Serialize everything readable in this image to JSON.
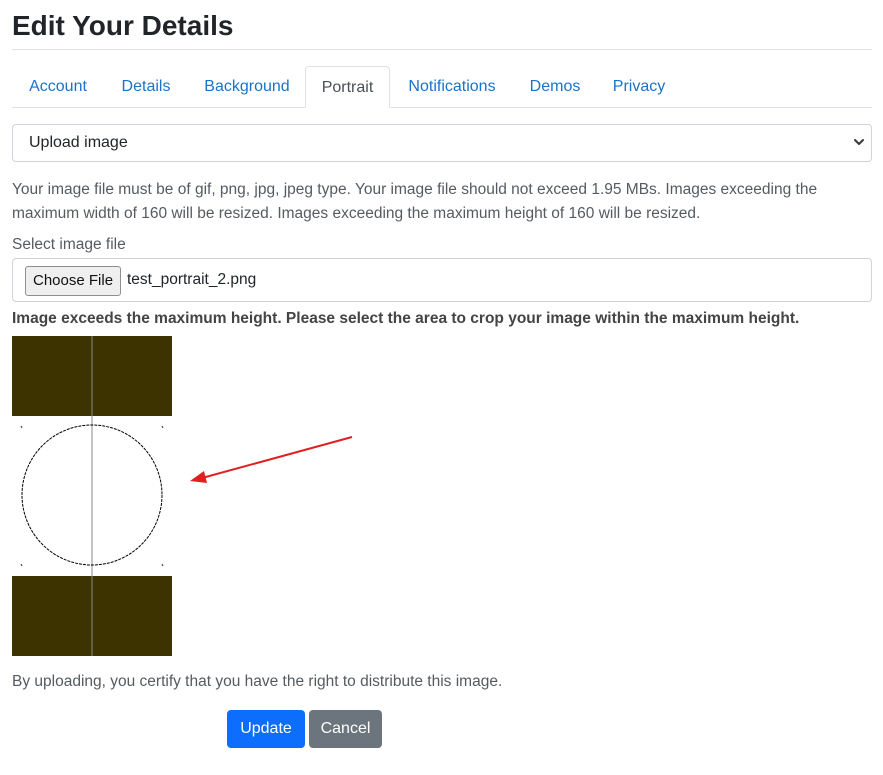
{
  "page": {
    "title": "Edit Your Details"
  },
  "tabs": [
    {
      "label": "Account"
    },
    {
      "label": "Details"
    },
    {
      "label": "Background"
    },
    {
      "label": "Portrait",
      "active": true
    },
    {
      "label": "Notifications"
    },
    {
      "label": "Demos"
    },
    {
      "label": "Privacy"
    }
  ],
  "source_select": {
    "value": "Upload image",
    "icon": "chevron-down-icon"
  },
  "help_text": "Your image file must be of gif, png, jpg, jpeg type. Your image file should not exceed 1.95 MBs. Images exceeding the maximum width of 160 will be resized. Images exceeding the maximum height of 160 will be resized.",
  "file_field": {
    "label": "Select image file",
    "button_label": "Choose File",
    "file_name": "test_portrait_2.png"
  },
  "crop": {
    "warning": "Image exceeds the maximum height. Please select the area to crop your image within the maximum height.",
    "mask_color": "#3d3300"
  },
  "certify_text": "By uploading, you certify that you have the right to distribute this image.",
  "actions": {
    "update_label": "Update",
    "cancel_label": "Cancel"
  },
  "colors": {
    "primary": "#0d6efd",
    "secondary": "#6c757d",
    "link": "#1a73c9",
    "annotation_arrow": "#e02020"
  }
}
